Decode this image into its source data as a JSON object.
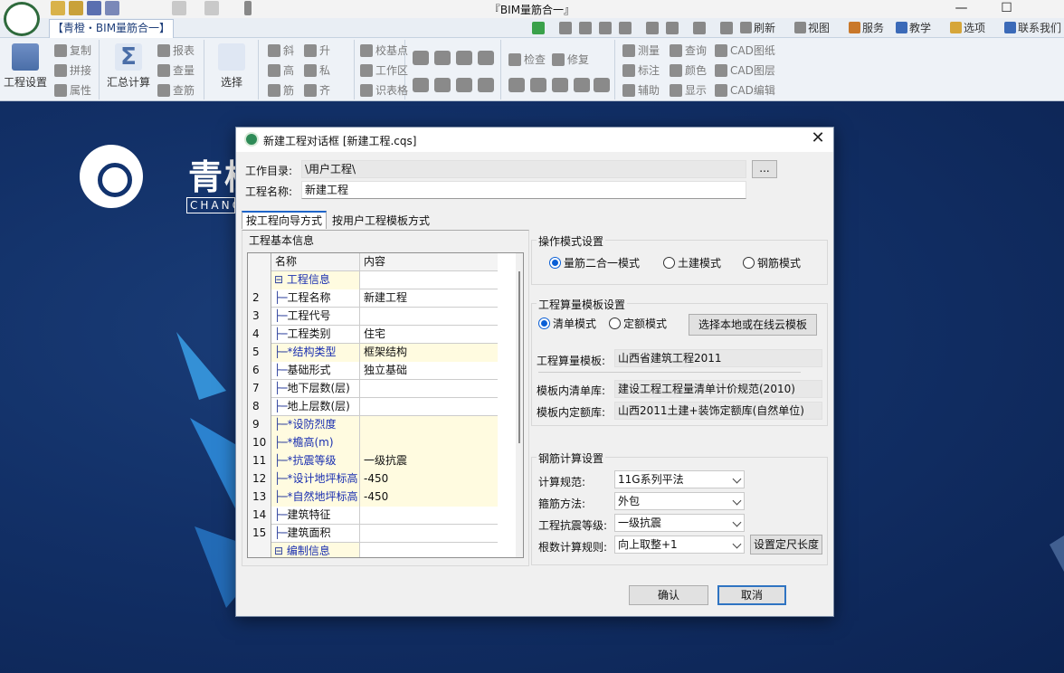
{
  "window": {
    "title": "『BIM量筋合一』",
    "app_tab": "【青橙・BIM量筋合一】",
    "minimize": "—",
    "maximize": "☐",
    "menu_right": [
      {
        "label": "刷新",
        "icon": "refresh-icon"
      },
      {
        "label": "视图",
        "icon": "view-icon"
      },
      {
        "label": "服务",
        "icon": "service-icon"
      },
      {
        "label": "教学",
        "icon": "teaching-icon"
      },
      {
        "label": "选项",
        "icon": "options-icon"
      },
      {
        "label": "联系我们",
        "icon": "contact-icon"
      }
    ]
  },
  "ribbon": {
    "project_settings": "工程设置",
    "copy": "复制",
    "splice": "拼接",
    "properties": "属性",
    "summary_calc": "汇总计算",
    "report": "报表",
    "view_quantity": "查量",
    "view_rebar": "查筋",
    "select": "选择",
    "slope": "斜",
    "raise": "升",
    "height": "高",
    "private": "私",
    "rebar": "筋",
    "align": "齐",
    "base_point": "校基点",
    "work_area": "工作区",
    "axis_net": "识表格",
    "check": "检查",
    "repair": "修复",
    "measure": "测量",
    "query": "查询",
    "cad_drawing": "CAD图纸",
    "annotate": "标注",
    "color": "颜色",
    "cad_layer": "CAD图层",
    "auxiliary": "辅助",
    "display": "显示",
    "cad_edit": "CAD编辑"
  },
  "brand": {
    "name": "青橙",
    "sub": "CHANGE"
  },
  "dialog": {
    "title": "新建工程对话框 [新建工程.cqs]",
    "work_dir_label": "工作目录:",
    "work_dir_value": "\\用户工程\\",
    "browse_button": "...",
    "project_name_label": "工程名称:",
    "project_name_value": "新建工程",
    "tabs": [
      "按工程向导方式",
      "按用户工程模板方式"
    ],
    "basic_info_title": "工程基本信息",
    "grid_headers": {
      "name": "名称",
      "content": "内容"
    },
    "grid_rows": [
      {
        "num": "",
        "name": "工程信息",
        "value": "",
        "kind": "group"
      },
      {
        "num": "2",
        "name": "工程名称",
        "value": "新建工程",
        "kind": "normal"
      },
      {
        "num": "3",
        "name": "工程代号",
        "value": "",
        "kind": "normal"
      },
      {
        "num": "4",
        "name": "工程类别",
        "value": "住宅",
        "kind": "normal"
      },
      {
        "num": "5",
        "name": "*结构类型",
        "value": "框架结构",
        "kind": "req"
      },
      {
        "num": "6",
        "name": "基础形式",
        "value": "独立基础",
        "kind": "normal"
      },
      {
        "num": "7",
        "name": "地下层数(层)",
        "value": "",
        "kind": "normal"
      },
      {
        "num": "8",
        "name": "地上层数(层)",
        "value": "",
        "kind": "normal"
      },
      {
        "num": "9",
        "name": "*设防烈度",
        "value": "",
        "kind": "req"
      },
      {
        "num": "10",
        "name": "*檐高(m)",
        "value": "",
        "kind": "req"
      },
      {
        "num": "11",
        "name": "*抗震等级",
        "value": "一级抗震",
        "kind": "req"
      },
      {
        "num": "12",
        "name": "*设计地坪标高",
        "value": "-450",
        "kind": "req"
      },
      {
        "num": "13",
        "name": "*自然地坪标高",
        "value": "-450",
        "kind": "req"
      },
      {
        "num": "14",
        "name": "建筑特征",
        "value": "",
        "kind": "normal"
      },
      {
        "num": "15",
        "name": "建筑面积",
        "value": "",
        "kind": "normal"
      },
      {
        "num": "",
        "name": "编制信息",
        "value": "",
        "kind": "group"
      }
    ],
    "op_mode": {
      "title": "操作模式设置",
      "options": [
        "量筋二合一模式",
        "土建模式",
        "钢筋模式"
      ],
      "selected": 0
    },
    "calc_template": {
      "title": "工程算量模板设置",
      "options": [
        "清单模式",
        "定额模式"
      ],
      "selected": 0,
      "select_button": "选择本地或在线云模板",
      "template_label": "工程算量模板:",
      "template_value": "山西省建筑工程2011",
      "list_label": "模板内清单库:",
      "list_value": "建设工程工程量清单计价规范(2010)",
      "quota_label": "模板内定额库:",
      "quota_value": "山西2011土建+装饰定额库(自然单位)"
    },
    "rebar_calc": {
      "title": "钢筋计算设置",
      "spec_label": "计算规范:",
      "spec_value": "11G系列平法",
      "stirrup_label": "箍筋方法:",
      "stirrup_value": "外包",
      "seismic_label": "工程抗震等级:",
      "seismic_value": "一级抗震",
      "count_label": "根数计算规则:",
      "count_value": "向上取整+1",
      "fixed_length_button": "设置定尺长度"
    },
    "ok_button": "确认",
    "cancel_button": "取消"
  },
  "colors": {
    "background": "#123067",
    "accent": "#0a5fd6",
    "required_row": "#fffbe0"
  }
}
